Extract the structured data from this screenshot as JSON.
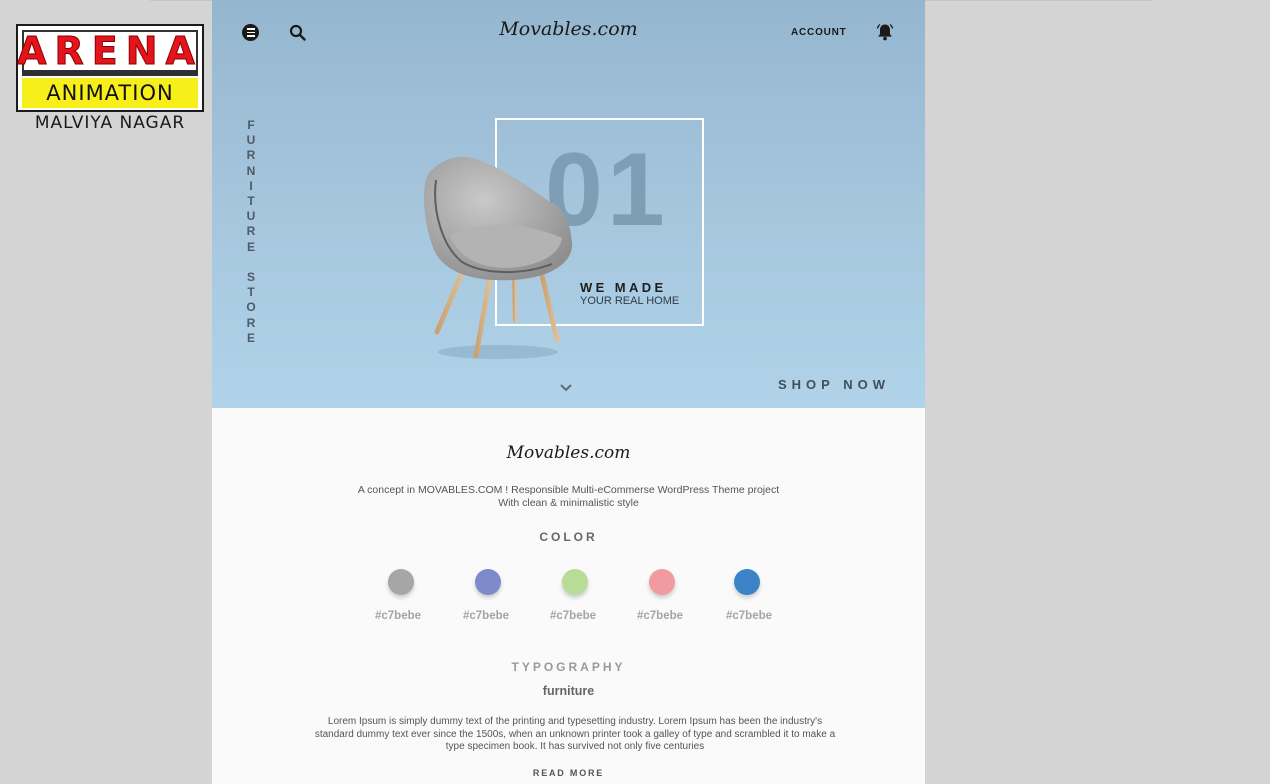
{
  "watermark": {
    "line1": "ARENA",
    "line2": "ANIMATION",
    "line3": "MALVIYA NAGAR"
  },
  "header": {
    "brand": "Movables.com",
    "account_label": "ACCOUNT",
    "menu_icon": "menu-icon",
    "search_icon": "search-icon",
    "bell_icon": "bell-icon"
  },
  "hero": {
    "vertical_text": [
      "F",
      "U",
      "R",
      "N",
      "I",
      "T",
      "U",
      "R",
      "E",
      " ",
      "S",
      "T",
      "O",
      "R",
      "E"
    ],
    "number": "01",
    "headline": "WE MADE",
    "subline": "YOUR REAL HOME",
    "cta": "SHOP NOW",
    "background_color": "#a6c7de"
  },
  "intro": {
    "brand": "Movables.com",
    "description_line1": "A concept in MOVABLES.COM ! Responsible Multi-eCommerse WordPress Theme project",
    "description_line2": "With clean & minimalistic style"
  },
  "colors": {
    "title": "COLOR",
    "swatches": [
      {
        "fill": "#a6a6a6",
        "label": "#c7bebe"
      },
      {
        "fill": "#7f8acb",
        "label": "#c7bebe"
      },
      {
        "fill": "#b8dc95",
        "label": "#c7bebe"
      },
      {
        "fill": "#f19ba1",
        "label": "#c7bebe"
      },
      {
        "fill": "#3b82c8",
        "label": "#c7bebe"
      }
    ]
  },
  "typography": {
    "title": "TYPOGRAPHY",
    "sample_word": "furniture",
    "lorem": "Lorem Ipsum is simply dummy text of the printing and typesetting industry. Lorem Ipsum has been the industry's standard dummy text ever since the 1500s, when an unknown printer took a galley of type and scrambled it to make a type specimen book. It has survived not only five centuries",
    "read_more": "READ MORE"
  }
}
